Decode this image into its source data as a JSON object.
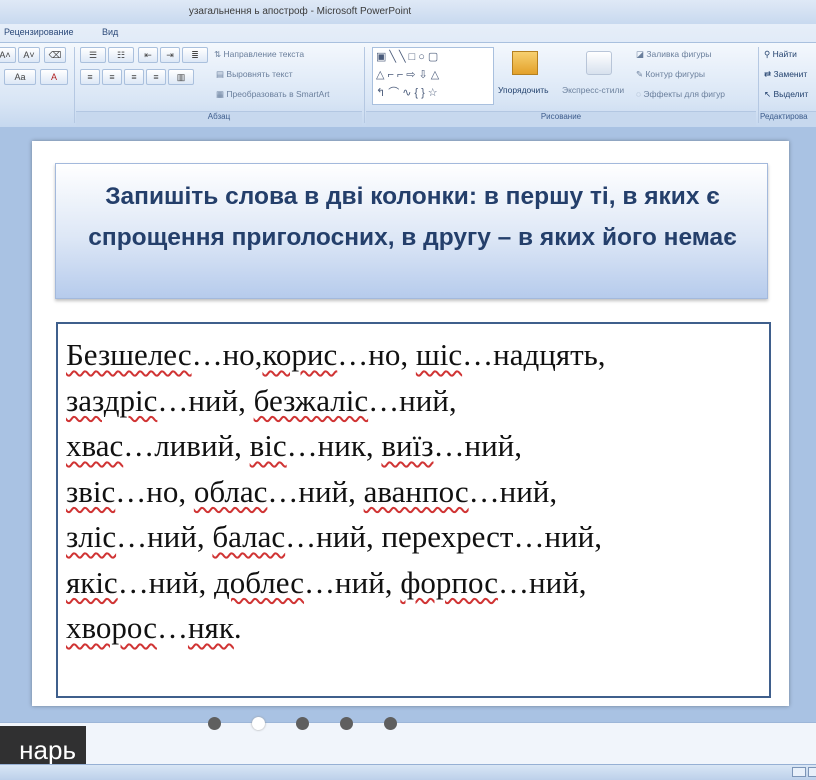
{
  "window": {
    "title": "узагальнення ь апостроф - Microsoft PowerPoint"
  },
  "ribbon": {
    "tabs": [
      "Рецензирование",
      "Вид"
    ],
    "paragraph_group": {
      "label": "Абзац",
      "text_direction": "Направление текста",
      "align_text": "Выровнять текст",
      "smartart": "Преобразовать в SmartArt"
    },
    "drawing_group": {
      "label": "Рисование",
      "arrange": "Упорядочить",
      "quick_styles": "Экспресс-стили",
      "shape_fill": "Заливка фигуры",
      "shape_outline": "Контур фигуры",
      "shape_effects": "Эффекты для фигур"
    },
    "editing_group": {
      "label": "Редактирова",
      "find": "Найти",
      "replace": "Заменит",
      "select": "Выделит"
    },
    "font_buttons": [
      "A˄",
      "A˅",
      "Aa"
    ]
  },
  "slide": {
    "title": "Запишіть слова в дві колонки: в першу ті, в яких є спрощення приголосних, в другу – в яких його немає",
    "lines": [
      [
        {
          "t": "Безшелес",
          "u": true
        },
        {
          "t": "…но,",
          "u": false
        },
        {
          "t": "корис",
          "u": true
        },
        {
          "t": "…но, ",
          "u": false
        },
        {
          "t": "шіс",
          "u": true
        },
        {
          "t": "…надцять,",
          "u": false
        }
      ],
      [
        {
          "t": "заздріс",
          "u": true
        },
        {
          "t": "…ний, ",
          "u": false
        },
        {
          "t": "безжаліс",
          "u": true
        },
        {
          "t": "…ний,",
          "u": false
        }
      ],
      [
        {
          "t": "хвас",
          "u": true
        },
        {
          "t": "…ливий, ",
          "u": false
        },
        {
          "t": "віс",
          "u": true
        },
        {
          "t": "…ник, ",
          "u": false
        },
        {
          "t": "виїз",
          "u": true
        },
        {
          "t": "…ний,",
          "u": false
        }
      ],
      [
        {
          "t": "звіс",
          "u": true
        },
        {
          "t": "…но, ",
          "u": false
        },
        {
          "t": "облас",
          "u": true
        },
        {
          "t": "…ний, ",
          "u": false
        },
        {
          "t": "аванпос",
          "u": true
        },
        {
          "t": "…ний,",
          "u": false
        }
      ],
      [
        {
          "t": "зліс",
          "u": true
        },
        {
          "t": "…ний, ",
          "u": false
        },
        {
          "t": "балас",
          "u": true
        },
        {
          "t": "…ний, перехрест…ний,",
          "u": false
        }
      ],
      [
        {
          "t": "якіс",
          "u": true
        },
        {
          "t": "…ний, ",
          "u": false
        },
        {
          "t": "доблес",
          "u": true
        },
        {
          "t": "…ний, ",
          "u": false
        },
        {
          "t": "форпос",
          "u": true
        },
        {
          "t": "…ний,",
          "u": false
        }
      ],
      [
        {
          "t": "хворос",
          "u": true
        },
        {
          "t": "…",
          "u": false
        },
        {
          "t": "няк",
          "u": true
        },
        {
          "t": ".",
          "u": false
        }
      ]
    ]
  },
  "overlay": {
    "label": "нарь"
  },
  "slide_dots": {
    "count": 5,
    "active_index": 1
  },
  "colors": {
    "title_text": "#243f6b",
    "content_border": "#3f5f8c",
    "spellcheck_underline": "#d03434",
    "workspace_bg": "#a9c2e3"
  }
}
